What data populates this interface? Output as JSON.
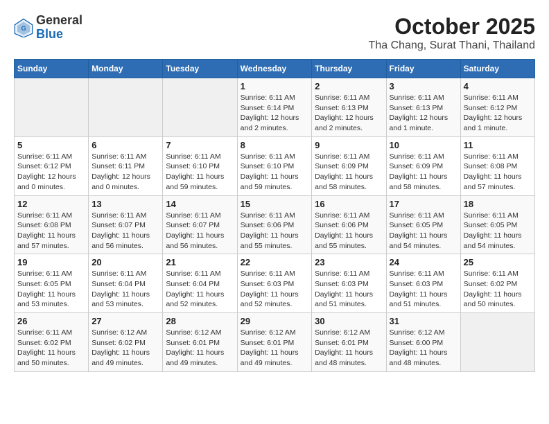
{
  "header": {
    "logo_general": "General",
    "logo_blue": "Blue",
    "title": "October 2025",
    "subtitle": "Tha Chang, Surat Thani, Thailand"
  },
  "weekdays": [
    "Sunday",
    "Monday",
    "Tuesday",
    "Wednesday",
    "Thursday",
    "Friday",
    "Saturday"
  ],
  "weeks": [
    [
      {
        "day": "",
        "info": ""
      },
      {
        "day": "",
        "info": ""
      },
      {
        "day": "",
        "info": ""
      },
      {
        "day": "1",
        "info": "Sunrise: 6:11 AM\nSunset: 6:14 PM\nDaylight: 12 hours\nand 2 minutes."
      },
      {
        "day": "2",
        "info": "Sunrise: 6:11 AM\nSunset: 6:13 PM\nDaylight: 12 hours\nand 2 minutes."
      },
      {
        "day": "3",
        "info": "Sunrise: 6:11 AM\nSunset: 6:13 PM\nDaylight: 12 hours\nand 1 minute."
      },
      {
        "day": "4",
        "info": "Sunrise: 6:11 AM\nSunset: 6:12 PM\nDaylight: 12 hours\nand 1 minute."
      }
    ],
    [
      {
        "day": "5",
        "info": "Sunrise: 6:11 AM\nSunset: 6:12 PM\nDaylight: 12 hours\nand 0 minutes."
      },
      {
        "day": "6",
        "info": "Sunrise: 6:11 AM\nSunset: 6:11 PM\nDaylight: 12 hours\nand 0 minutes."
      },
      {
        "day": "7",
        "info": "Sunrise: 6:11 AM\nSunset: 6:10 PM\nDaylight: 11 hours\nand 59 minutes."
      },
      {
        "day": "8",
        "info": "Sunrise: 6:11 AM\nSunset: 6:10 PM\nDaylight: 11 hours\nand 59 minutes."
      },
      {
        "day": "9",
        "info": "Sunrise: 6:11 AM\nSunset: 6:09 PM\nDaylight: 11 hours\nand 58 minutes."
      },
      {
        "day": "10",
        "info": "Sunrise: 6:11 AM\nSunset: 6:09 PM\nDaylight: 11 hours\nand 58 minutes."
      },
      {
        "day": "11",
        "info": "Sunrise: 6:11 AM\nSunset: 6:08 PM\nDaylight: 11 hours\nand 57 minutes."
      }
    ],
    [
      {
        "day": "12",
        "info": "Sunrise: 6:11 AM\nSunset: 6:08 PM\nDaylight: 11 hours\nand 57 minutes."
      },
      {
        "day": "13",
        "info": "Sunrise: 6:11 AM\nSunset: 6:07 PM\nDaylight: 11 hours\nand 56 minutes."
      },
      {
        "day": "14",
        "info": "Sunrise: 6:11 AM\nSunset: 6:07 PM\nDaylight: 11 hours\nand 56 minutes."
      },
      {
        "day": "15",
        "info": "Sunrise: 6:11 AM\nSunset: 6:06 PM\nDaylight: 11 hours\nand 55 minutes."
      },
      {
        "day": "16",
        "info": "Sunrise: 6:11 AM\nSunset: 6:06 PM\nDaylight: 11 hours\nand 55 minutes."
      },
      {
        "day": "17",
        "info": "Sunrise: 6:11 AM\nSunset: 6:05 PM\nDaylight: 11 hours\nand 54 minutes."
      },
      {
        "day": "18",
        "info": "Sunrise: 6:11 AM\nSunset: 6:05 PM\nDaylight: 11 hours\nand 54 minutes."
      }
    ],
    [
      {
        "day": "19",
        "info": "Sunrise: 6:11 AM\nSunset: 6:05 PM\nDaylight: 11 hours\nand 53 minutes."
      },
      {
        "day": "20",
        "info": "Sunrise: 6:11 AM\nSunset: 6:04 PM\nDaylight: 11 hours\nand 53 minutes."
      },
      {
        "day": "21",
        "info": "Sunrise: 6:11 AM\nSunset: 6:04 PM\nDaylight: 11 hours\nand 52 minutes."
      },
      {
        "day": "22",
        "info": "Sunrise: 6:11 AM\nSunset: 6:03 PM\nDaylight: 11 hours\nand 52 minutes."
      },
      {
        "day": "23",
        "info": "Sunrise: 6:11 AM\nSunset: 6:03 PM\nDaylight: 11 hours\nand 51 minutes."
      },
      {
        "day": "24",
        "info": "Sunrise: 6:11 AM\nSunset: 6:03 PM\nDaylight: 11 hours\nand 51 minutes."
      },
      {
        "day": "25",
        "info": "Sunrise: 6:11 AM\nSunset: 6:02 PM\nDaylight: 11 hours\nand 50 minutes."
      }
    ],
    [
      {
        "day": "26",
        "info": "Sunrise: 6:11 AM\nSunset: 6:02 PM\nDaylight: 11 hours\nand 50 minutes."
      },
      {
        "day": "27",
        "info": "Sunrise: 6:12 AM\nSunset: 6:02 PM\nDaylight: 11 hours\nand 49 minutes."
      },
      {
        "day": "28",
        "info": "Sunrise: 6:12 AM\nSunset: 6:01 PM\nDaylight: 11 hours\nand 49 minutes."
      },
      {
        "day": "29",
        "info": "Sunrise: 6:12 AM\nSunset: 6:01 PM\nDaylight: 11 hours\nand 49 minutes."
      },
      {
        "day": "30",
        "info": "Sunrise: 6:12 AM\nSunset: 6:01 PM\nDaylight: 11 hours\nand 48 minutes."
      },
      {
        "day": "31",
        "info": "Sunrise: 6:12 AM\nSunset: 6:00 PM\nDaylight: 11 hours\nand 48 minutes."
      },
      {
        "day": "",
        "info": ""
      }
    ]
  ]
}
